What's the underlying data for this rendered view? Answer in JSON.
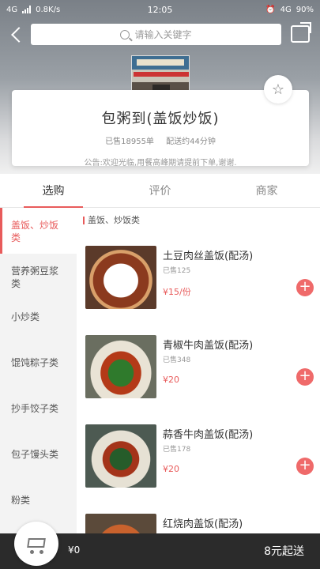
{
  "status_bar": {
    "network": "4G",
    "speed": "0.8K/s",
    "time": "12:05",
    "battery": "90%",
    "network_right": "4G"
  },
  "search": {
    "placeholder": "请输入关键字"
  },
  "shop": {
    "name": "包粥到(盖饭炒饭)",
    "sold": "已售18955单",
    "delivery": "配送约44分钟",
    "notice": "公告:欢迎光临,用餐高峰期请提前下单,谢谢."
  },
  "tabs": [
    {
      "label": "选购",
      "active": true
    },
    {
      "label": "评价",
      "active": false
    },
    {
      "label": "商家",
      "active": false
    }
  ],
  "categories": [
    {
      "label": "盖饭、炒饭类",
      "active": true
    },
    {
      "label": "营养粥豆浆类",
      "active": false
    },
    {
      "label": "小炒类",
      "active": false
    },
    {
      "label": "馄饨粽子类",
      "active": false
    },
    {
      "label": "抄手饺子类",
      "active": false
    },
    {
      "label": "包子馒头类",
      "active": false
    },
    {
      "label": "粉类",
      "active": false
    }
  ],
  "section_title": "盖饭、炒饭类",
  "dishes": [
    {
      "name": "土豆肉丝盖饭(配汤)",
      "sold": "已售125",
      "price": "¥15/份"
    },
    {
      "name": "青椒牛肉盖饭(配汤)",
      "sold": "已售348",
      "price": "¥20"
    },
    {
      "name": "蒜香牛肉盖饭(配汤)",
      "sold": "已售178",
      "price": "¥20"
    },
    {
      "name": "红烧肉盖饭(配汤)",
      "sold": "",
      "price": ""
    }
  ],
  "cart": {
    "total": "¥0",
    "min_order": "8元起送"
  },
  "colors": {
    "accent": "#e85b5b",
    "bottom_bar": "#2b2b2b"
  }
}
